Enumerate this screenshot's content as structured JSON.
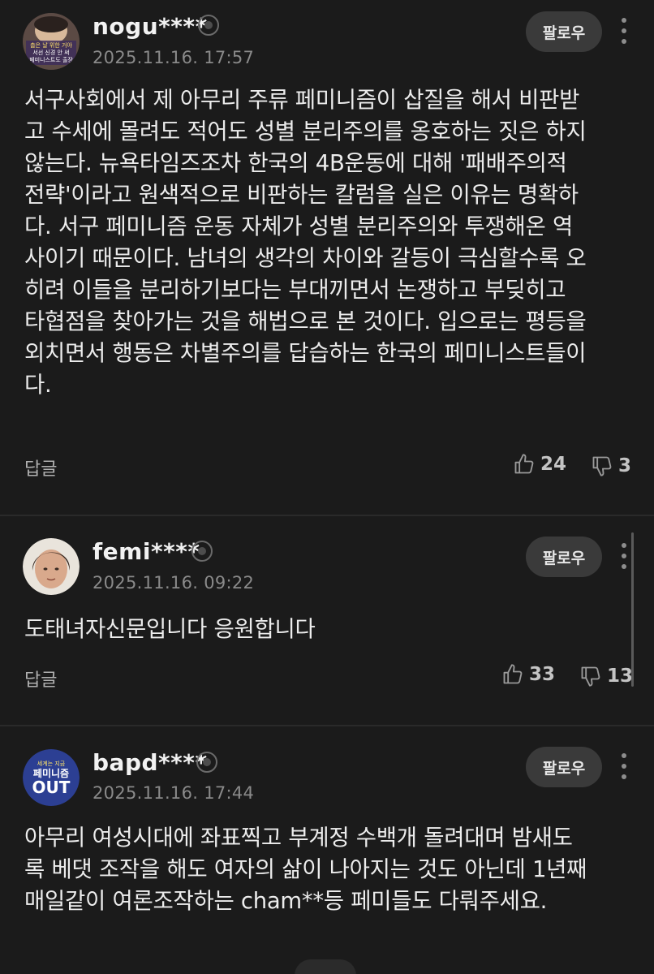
{
  "comments": [
    {
      "username": "nogu****",
      "timestamp": "2025.11.16. 17:57",
      "avatar_text": [
        "춥은 날 위한 거야",
        "서선 신경 안 써",
        "페미니스트도 출장"
      ],
      "follow_label": "팔로우",
      "body": "서구사회에서 제 아무리 주류 페미니즘이 삽질을 해서 비판받고 수세에 몰려도 적어도 성별 분리주의를 옹호하는 짓은 하지 않는다. 뉴욕타임즈조차 한국의 4B운동에 대해 '패배주의적 전략'이라고 원색적으로 비판하는 칼럼을 실은 이유는 명확하다. 서구 페미니즘 운동 자체가 성별 분리주의와 투쟁해온 역사이기 때문이다. 남녀의 생각의 차이와 갈등이 극심할수록 오히려 이들을 분리하기보다는 부대끼면서 논쟁하고 부딪히고 타협점을 찾아가는 것을 해법으로 본 것이다. 입으로는 평등을 외치면서 행동은 차별주의를 답습하는 한국의 페미니스트들이다.",
      "reply_label": "답글",
      "likes": "24",
      "dislikes": "3"
    },
    {
      "username": "femi****",
      "timestamp": "2025.11.16. 09:22",
      "follow_label": "팔로우",
      "body": "도태녀자신문입니다 응원합니다",
      "reply_label": "답글",
      "likes": "33",
      "dislikes": "13"
    },
    {
      "username": "bapd****",
      "timestamp": "2025.11.16. 17:44",
      "avatar_text": [
        "세계는 지금",
        "페미니즘",
        "OUT"
      ],
      "follow_label": "팔로우",
      "body": "아무리 여성시대에 좌표찍고 부계정 수백개 돌려대며 밤새도록 베댓 조작을 해도 여자의 삶이 나아지는 것도 아닌데 1년째 매일같이 여론조작하는 cham**등 페미들도 다뤄주세요."
    }
  ],
  "colors": {
    "background": "#1b1b1b",
    "text": "#ececec",
    "muted": "#8a8a8a",
    "follow_bg": "#3a3a3a"
  },
  "icons": [
    "verified-badge-icon",
    "more-vertical-icon",
    "thumbs-up-icon",
    "thumbs-down-icon"
  ]
}
